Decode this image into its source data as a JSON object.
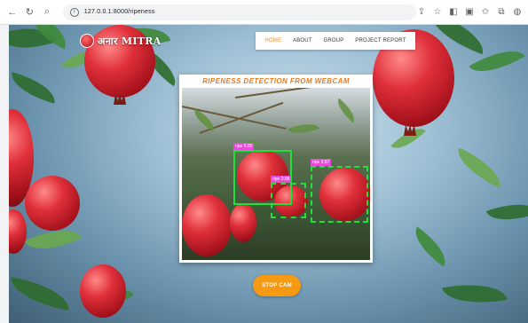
{
  "browser": {
    "url": "127.0.0.1:8000/ripeness",
    "icons": [
      "back-icon",
      "forward-icon",
      "reload-icon",
      "search-icon",
      "info-icon",
      "share-icon",
      "star-icon",
      "extension-icon",
      "reader-icon",
      "favorites-icon",
      "collections-icon",
      "profile-icon"
    ]
  },
  "site": {
    "brand": "अनार MITRA"
  },
  "nav": {
    "items": [
      {
        "label": "HOME",
        "active": true
      },
      {
        "label": "ABOUT",
        "active": false
      },
      {
        "label": "GROUP",
        "active": false
      },
      {
        "label": "PROJECT REPORT",
        "active": false
      }
    ]
  },
  "detection": {
    "title": "RIPENESS DETECTION FROM WEBCAM",
    "labels": [
      "ripe 0.85",
      "ripe 0.88",
      "ripe 0.87"
    ]
  },
  "actions": {
    "stop_label": "STOP CAM"
  },
  "colors": {
    "accent": "#f59a12",
    "nav_active": "#f08a24",
    "title": "#e87a1e",
    "box": "#22e03a",
    "tag": "#e84bd8"
  }
}
